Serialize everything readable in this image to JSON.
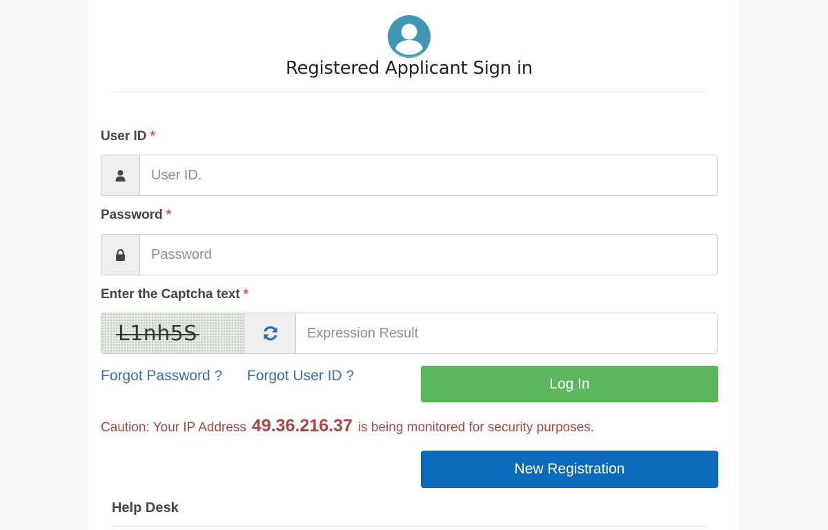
{
  "header": {
    "title": "Registered Applicant Sign in",
    "avatar_icon": "user-circle-icon",
    "avatar_color": "#3f97b4"
  },
  "form": {
    "user_id": {
      "label": "User ID",
      "required_mark": "*",
      "placeholder": "User ID.",
      "value": "",
      "icon": "user-icon"
    },
    "password": {
      "label": "Password",
      "required_mark": "*",
      "placeholder": "Password",
      "value": "",
      "icon": "lock-icon"
    },
    "captcha": {
      "label": "Enter the Captcha text",
      "required_mark": "*",
      "captcha_text": "L1nh5S",
      "refresh_icon": "refresh-icon",
      "placeholder": "Expression Result",
      "value": ""
    }
  },
  "links": {
    "forgot_password": "Forgot Password ?",
    "forgot_user_id": "Forgot User ID ?"
  },
  "buttons": {
    "login": "Log In",
    "new_registration": "New Registration"
  },
  "caution": {
    "prefix": "Caution: Your IP Address",
    "ip": "49.36.216.37",
    "suffix": "is being monitored for security purposes."
  },
  "help_desk": {
    "title": "Help Desk"
  },
  "colors": {
    "login_button": "#5cb85c",
    "registration_button": "#0b6bbb",
    "link": "#3a6ea8",
    "caution": "#a94442",
    "required": "#d9534f"
  }
}
